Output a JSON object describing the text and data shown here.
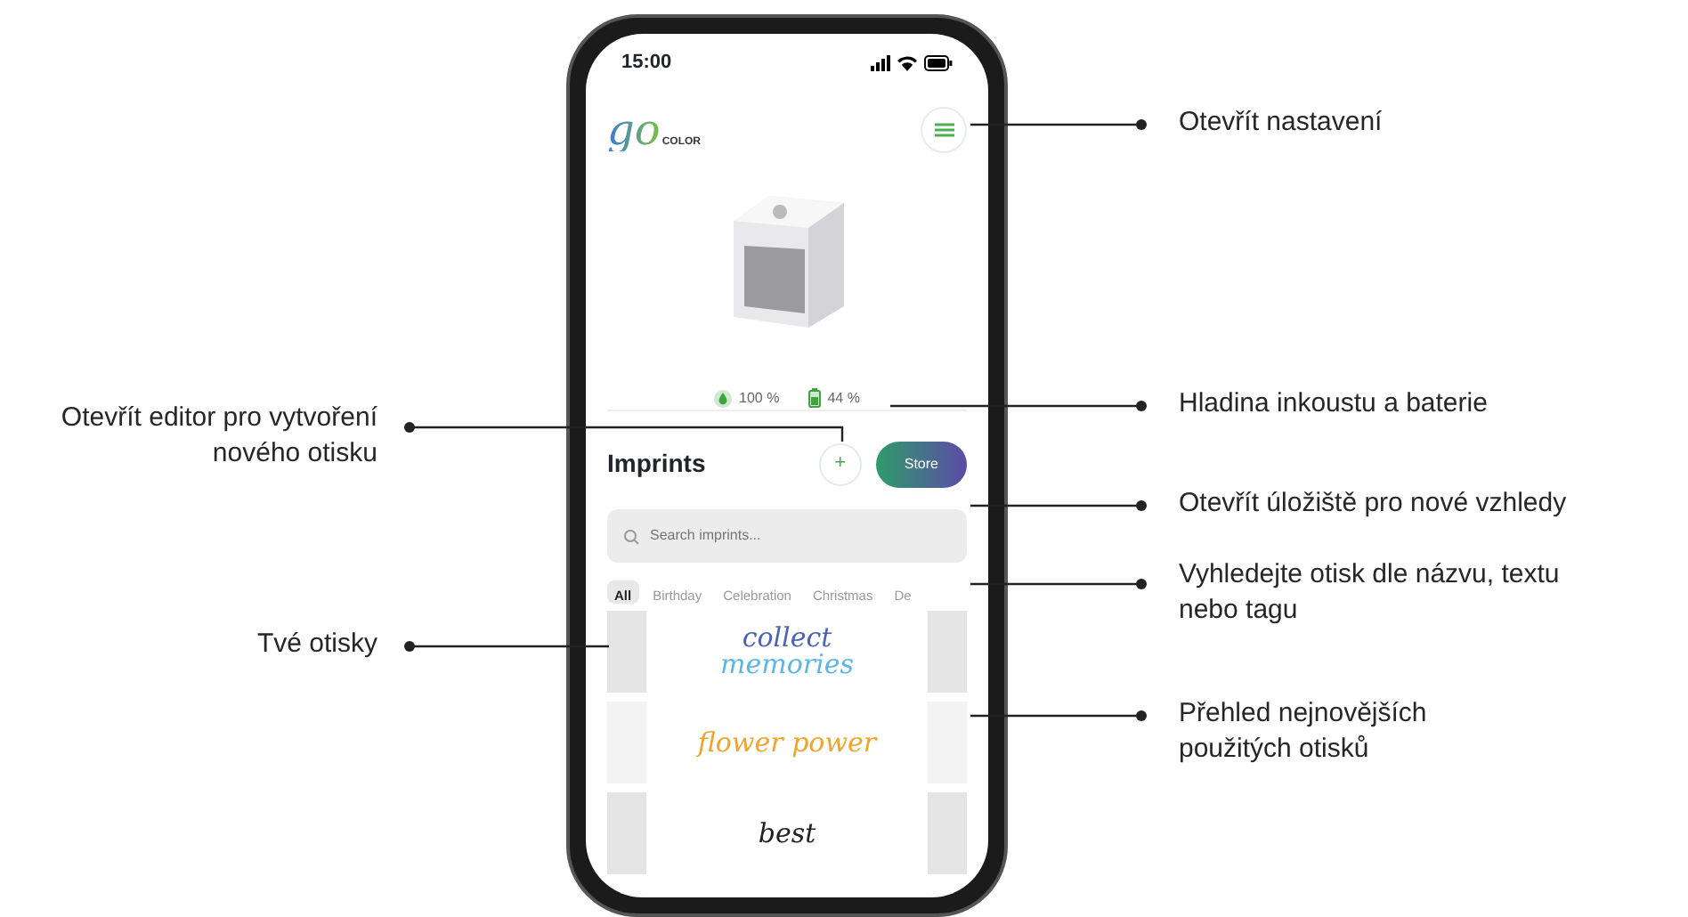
{
  "status_bar": {
    "time": "15:00"
  },
  "header": {
    "logo": {
      "word": "go",
      "brand": "COLOR"
    }
  },
  "levels": [
    {
      "kind": "ink",
      "reading": "100 %"
    },
    {
      "kind": "battery",
      "reading": "44 %"
    }
  ],
  "imprints": {
    "title": "Imprints",
    "add_label": "+",
    "store_button": "Store",
    "search": {
      "placeholder": "Search imprints..."
    },
    "tags": [
      {
        "label": "All",
        "selected": true
      },
      {
        "label": "Birthday",
        "selected": false
      },
      {
        "label": "Celebration",
        "selected": false
      },
      {
        "label": "Christmas",
        "selected": false
      },
      {
        "label": "De",
        "selected": false
      }
    ],
    "items": [
      {
        "lines": [
          {
            "text": "collect",
            "color": "#4b62b5"
          },
          {
            "text": "memories",
            "color": "#5bb7e8"
          }
        ]
      },
      {
        "lines": [
          {
            "text": "flower power",
            "color": "#f0a42c"
          }
        ]
      },
      {
        "lines": [
          {
            "text": "best",
            "color": "#222222"
          }
        ]
      }
    ]
  },
  "callouts": [
    {
      "kind": "right",
      "text": "Otevřít nastavení"
    },
    {
      "kind": "right",
      "text": "Hladina inkoustu a baterie"
    },
    {
      "kind": "left",
      "text": "Otevřít editor pro vytvoření nového otisku"
    },
    {
      "kind": "right",
      "text": "Otevřít úložiště pro nové vzhledy"
    },
    {
      "kind": "right",
      "text": "Vyhledejte otisk dle názvu, textu nebo tagu"
    },
    {
      "kind": "left",
      "text": "Tvé otisky"
    },
    {
      "kind": "right",
      "text": "Přehled nejnovějších použitých otisků"
    }
  ]
}
